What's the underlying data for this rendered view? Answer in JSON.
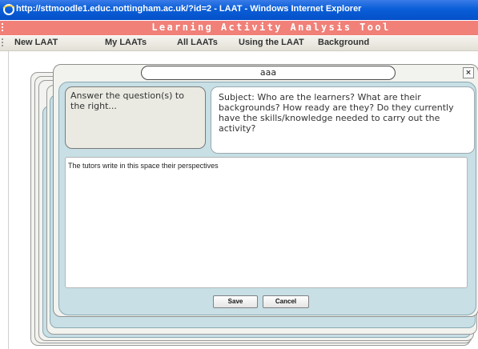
{
  "window": {
    "title": "http://sttmoodle1.educ.nottingham.ac.uk/?id=2 - LAAT - Windows Internet Explorer",
    "icon": "ie-icon"
  },
  "banner": {
    "title": "Learning Activity Analysis Tool",
    "color": "#f08078"
  },
  "menu": {
    "items": [
      "New LAAT",
      "My LAATs",
      "All LAATs",
      "Using the LAAT",
      "Background"
    ]
  },
  "dialog": {
    "title": "aaa",
    "close_label": "×",
    "question_prompt": "Answer the question(s) to the right...",
    "subject": "Subject: Who are the learners? What are their backgrounds? How ready are they? Do they currently have the skills/knowledge needed to carry out the activity?",
    "answer_value": "The tutors write in this space their perspectives",
    "save_label": "Save",
    "cancel_label": "Cancel",
    "panel_color": "#c7dfe5"
  }
}
